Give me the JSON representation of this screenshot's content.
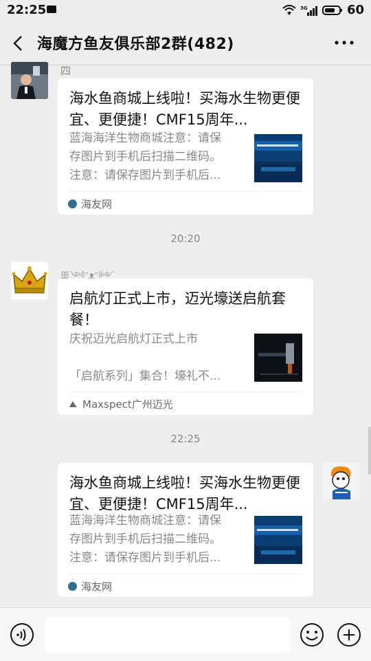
{
  "status": {
    "time": "22:25",
    "net": "3G",
    "battery": "60"
  },
  "header": {
    "title": "海魔方鱼友俱乐部2群(482)"
  },
  "timestamps": [
    "20:20",
    "22:25"
  ],
  "messages": [
    {
      "sender": "四驱车",
      "title": "海水鱼商城上线啦！买海水生物更便宜、更便捷！CMF15周年...",
      "desc_line1": "蓝海海洋生物商城注意：请保",
      "desc_line2": "存图片到手机后扫描二维码。",
      "desc_line3": "注意：请保存图片到手机后...",
      "source": "海友网"
    },
    {
      "sender": "ꕥ༺ᵔᴥᵔ༻ꕥ",
      "title": "启航灯正式上市，迈光壕送启航套餐！",
      "desc_line1": "庆祝迈光启航灯正式上市",
      "desc_line2": "",
      "desc_line3": "「启航系列」集合！壕礼不...",
      "source": "Maxspect广州迈光"
    },
    {
      "title": "海水鱼商城上线啦！买海水生物更便宜、更便捷！CMF15周年...",
      "desc_line1": "蓝海海洋生物商城注意：请保",
      "desc_line2": "存图片到手机后扫描二维码。",
      "desc_line3": "注意：请保存图片到手机后...",
      "source": "海友网"
    }
  ],
  "colors": {
    "background": "#ededed",
    "card": "#ffffff",
    "muted": "#888888",
    "source_icon": "#2f6f8f"
  }
}
